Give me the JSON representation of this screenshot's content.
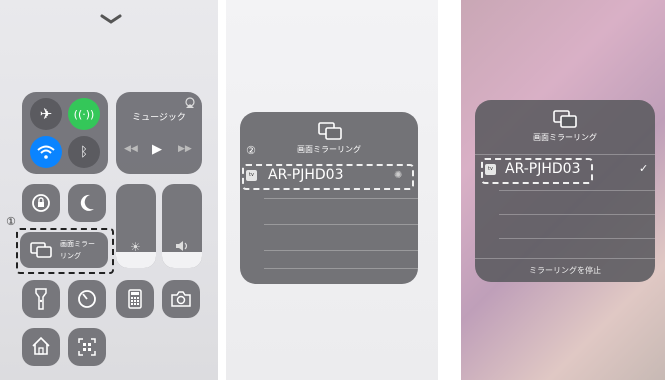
{
  "panel1": {
    "music_title": "ミュージック",
    "mirroring_label_line1": "画面ミラー",
    "mirroring_label_line2": "リング",
    "step_number": "①",
    "icons": {
      "chevron": "chevron-down-icon",
      "airplane": "airplane-icon",
      "cellular": "cellular-icon",
      "wifi": "wifi-icon",
      "bluetooth": "bluetooth-icon",
      "rotation_lock": "rotation-lock-icon",
      "do_not_disturb": "moon-icon",
      "flashlight": "flashlight-icon",
      "timer": "timer-icon",
      "calculator": "calculator-icon",
      "camera": "camera-icon",
      "home": "home-icon",
      "qr": "qr-code-icon",
      "airplay_audio": "airplay-icon"
    },
    "colors": {
      "cellular_green": "#34c759",
      "wifi_blue": "#0a84ff"
    }
  },
  "panel2": {
    "step_number": "②",
    "title": "画面ミラーリング",
    "device_name": "AR-PJHD03",
    "device_badge": "tv"
  },
  "panel3": {
    "title": "画面ミラーリング",
    "device_name": "AR-PJHD03",
    "device_badge": "tv",
    "checkmark": "✓",
    "stop_button": "ミラーリングを停止"
  }
}
